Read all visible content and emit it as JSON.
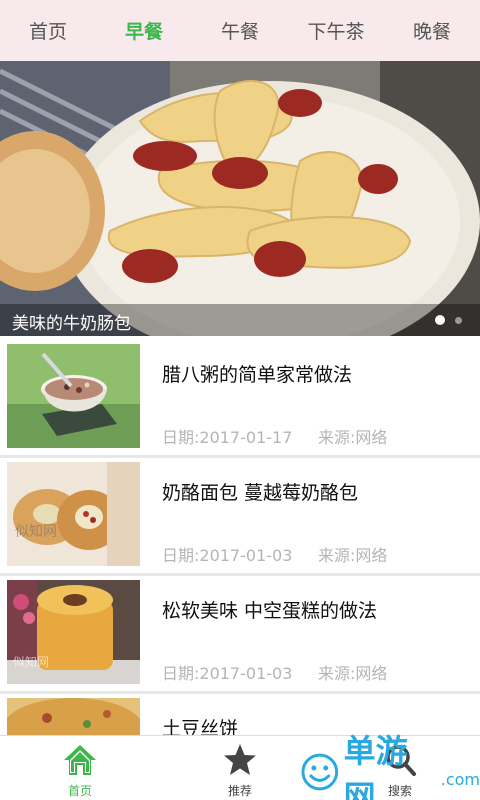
{
  "tabs": [
    {
      "label": "首页",
      "active": false
    },
    {
      "label": "早餐",
      "active": true
    },
    {
      "label": "午餐",
      "active": false
    },
    {
      "label": "下午茶",
      "active": false
    },
    {
      "label": "晚餐",
      "active": false
    }
  ],
  "banner": {
    "caption": "美味的牛奶肠包",
    "slide_count": 2,
    "current_slide": 1
  },
  "articles": [
    {
      "title": "腊八粥的简单家常做法",
      "date": "日期:2017-01-17",
      "source": "来源:网络"
    },
    {
      "title": "奶酪面包 蔓越莓奶酪包",
      "date": "日期:2017-01-03",
      "source": "来源:网络"
    },
    {
      "title": "松软美味 中空蛋糕的做法",
      "date": "日期:2017-01-03",
      "source": "来源:网络"
    },
    {
      "title": "土豆丝饼",
      "date": "",
      "source": ""
    }
  ],
  "bottom_nav": [
    {
      "label": "首页",
      "icon": "home-icon",
      "active": true
    },
    {
      "label": "推荐",
      "icon": "star-icon",
      "active": false
    },
    {
      "label": "搜索",
      "icon": "search-icon",
      "active": false
    }
  ],
  "watermark": {
    "text": "单游网",
    "suffix": ".com"
  },
  "colors": {
    "accent": "#3cb84b",
    "tabbar_bg": "#f8e9ec",
    "meta_text": "#b5b5b5",
    "watermark": "#2aa9e0"
  }
}
